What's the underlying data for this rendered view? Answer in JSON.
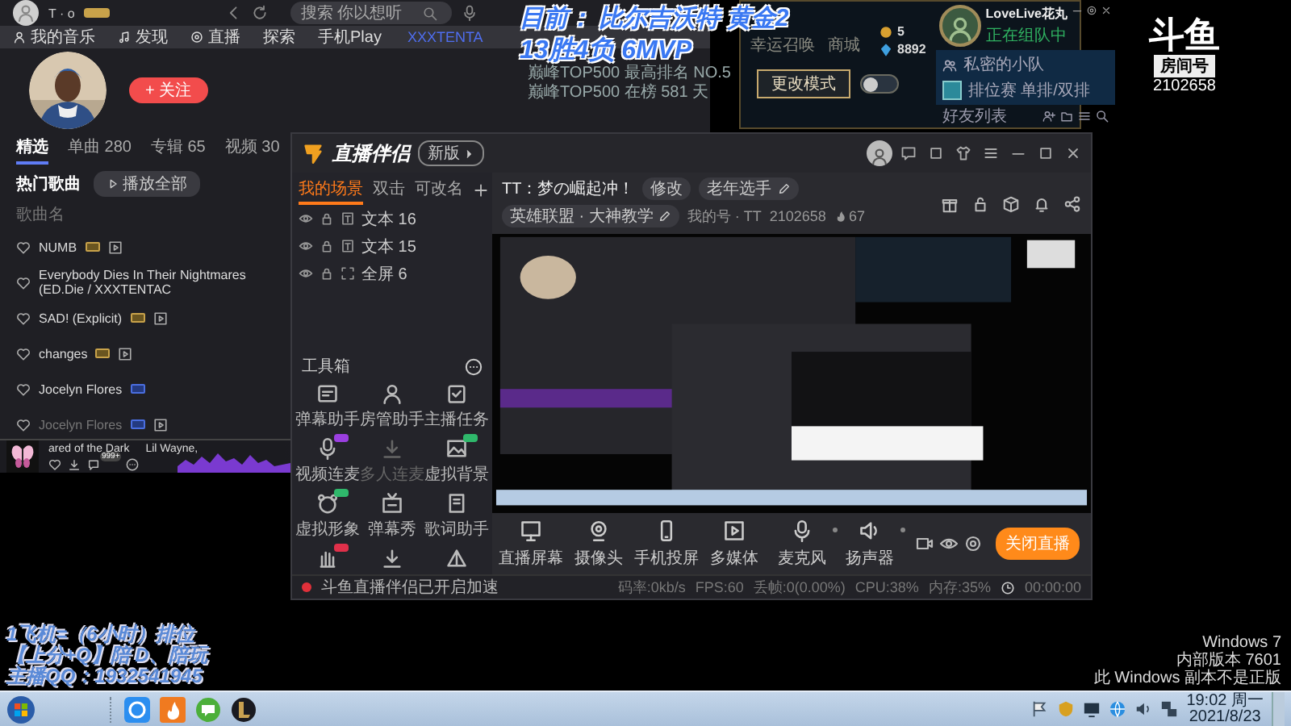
{
  "music_app": {
    "user": {
      "name": "T · o"
    },
    "search": {
      "placeholder": "搜索 你以想听"
    },
    "nav": [
      {
        "label": "我的音乐"
      },
      {
        "label": "发现"
      },
      {
        "label": "直播"
      },
      {
        "label": "探索"
      },
      {
        "label": "手机Play"
      }
    ],
    "artist_name": "XXXTENTA",
    "follow_button": "+ 关注",
    "tabs": [
      {
        "label": "精选",
        "selected": true
      },
      {
        "label": "单曲 280",
        "selected": false
      },
      {
        "label": "专辑 65",
        "selected": false
      },
      {
        "label": "视频 30",
        "selected": false
      }
    ],
    "section_title": "热门歌曲",
    "play_all": "播放全部",
    "column": "歌曲名",
    "songs": [
      {
        "title": "NUMB",
        "tags": [
          {
            "kind": "vip"
          },
          {
            "kind": "mv"
          }
        ],
        "disabled": false
      },
      {
        "title": "Everybody Dies In Their Nightmares (ED.Die / XXXTENTAC",
        "disabled": false
      },
      {
        "title": "SAD! (Explicit)",
        "tags": [
          {
            "kind": "vip"
          },
          {
            "kind": "mv"
          }
        ],
        "disabled": false
      },
      {
        "title": "changes",
        "tags": [
          {
            "kind": "vip"
          },
          {
            "kind": "mv"
          }
        ],
        "disabled": false
      },
      {
        "title": "Jocelyn Flores",
        "tags": [
          {
            "kind": "sq"
          }
        ],
        "disabled": false
      },
      {
        "title": "Jocelyn Flores",
        "tags": [
          {
            "kind": "sq"
          },
          {
            "kind": "mv"
          }
        ],
        "disabled": true
      }
    ],
    "player": {
      "title": "ared of the Dark",
      "artist": "Lil Wayne,",
      "comment_count": "999+"
    }
  },
  "stream_overlay": {
    "lines": [
      "目前： 比尔吉沃特 黄金2",
      "13胜4负 6MVP"
    ],
    "ranks": [
      "巅峰TOP500 最高排名 NO.5",
      "巅峰TOP500 在榜 581 天"
    ],
    "footer_lines": [
      "1飞机=（6小时）排位",
      "【上分+Q】陪 D、陪玩",
      "主播QQ：1932541945"
    ]
  },
  "game_client": {
    "labels": [
      "幸运召唤",
      "商城"
    ],
    "currency": [
      "5",
      "8892"
    ],
    "mode_button": "更改模式",
    "mode_toggle": {
      "on": false
    },
    "profile": {
      "name": "LoveLive花丸",
      "status": "正在组队中"
    },
    "party": {
      "title": "私密的小队",
      "queue": "排位赛 单排/双排"
    },
    "friends_title": "好友列表"
  },
  "room_logo": {
    "brand": "斗鱼",
    "label": "房间号",
    "number": "2102658"
  },
  "streaming_app": {
    "title": "直播伴侣",
    "version_button": "新版",
    "scene_tabs": [
      {
        "label": "我的场景",
        "selected": true
      },
      {
        "label": "双击",
        "selected": false
      },
      {
        "label": "可改名",
        "selected": false
      }
    ],
    "sources": [
      {
        "kind": "text",
        "label": "文本 16"
      },
      {
        "kind": "text",
        "label": "文本 15"
      },
      {
        "kind": "screen",
        "label": "全屏 6"
      }
    ],
    "toolbox_title": "工具箱",
    "tools": [
      {
        "label": "弹幕助手",
        "disabled": false
      },
      {
        "label": "房管助手",
        "disabled": false
      },
      {
        "label": "主播任务",
        "disabled": false
      },
      {
        "label": "视频连麦",
        "color": "#9b3fe0",
        "disabled": false
      },
      {
        "label": "多人连麦",
        "disabled": true
      },
      {
        "label": "虚拟背景",
        "color": "#2fb86b",
        "disabled": false
      },
      {
        "label": "虚拟形象",
        "color": "#2fb86b",
        "disabled": false
      },
      {
        "label": "弹幕秀",
        "disabled": false
      },
      {
        "label": "歌词助手",
        "disabled": false
      },
      {
        "color": "#e0304a",
        "disabled": false
      },
      {
        "disabled": false
      },
      {
        "disabled": false
      }
    ],
    "room_title": "TT：梦の崛起冲！",
    "edit_button": "修改",
    "tag_field": "老年选手",
    "category": "英雄联盟 · 大神教学",
    "streamer": "我的号 · TT",
    "room_id": "2102658",
    "heat": "67",
    "controls": [
      {
        "label": "直播屏幕",
        "dropdown": false
      },
      {
        "label": "摄像头",
        "dropdown": false
      },
      {
        "label": "手机投屏",
        "dropdown": false
      },
      {
        "label": "多媒体",
        "dropdown": false
      },
      {
        "label": "麦克风",
        "dropdown": true
      },
      {
        "label": "扬声器",
        "dropdown": true
      }
    ],
    "stop_button": "关闭直播",
    "status_message": "斗鱼直播伴侣已开启加速",
    "stats": [
      "码率:0kb/s",
      "FPS:60",
      "丢帧:0(0.00%)",
      "CPU:38%",
      "内存:35%"
    ],
    "duration": "00:00:00"
  },
  "desktop_notice": [
    "Windows 7",
    "内部版本 7601",
    "此 Windows 副本不是正版"
  ],
  "taskbar": {
    "time": "19:02 周一",
    "date": "2021/8/23"
  }
}
